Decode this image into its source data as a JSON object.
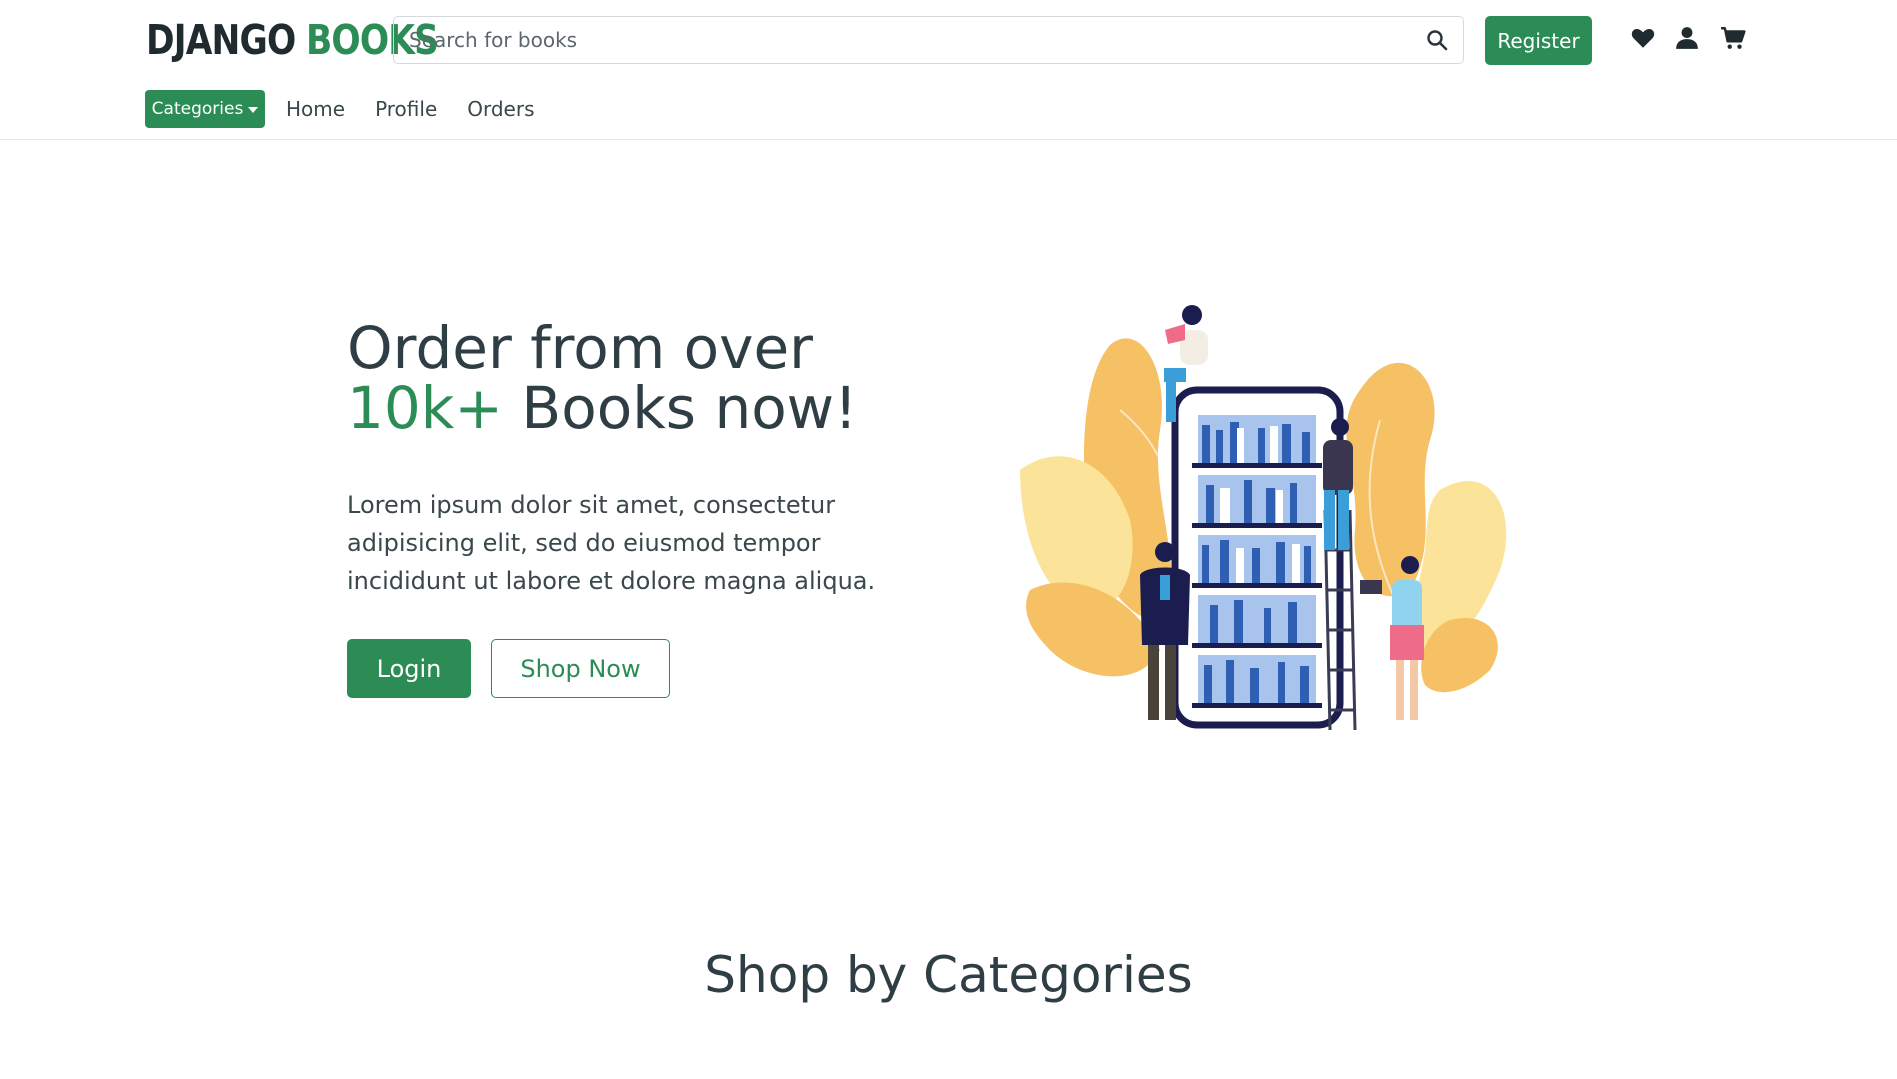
{
  "brand": {
    "part1": "DJANGO",
    "part2": "BOOKS",
    "color": "#2c8c56"
  },
  "search": {
    "placeholder": "Search for books",
    "value": ""
  },
  "header": {
    "register_label": "Register",
    "icons": [
      "heart-icon",
      "user-icon",
      "cart-icon"
    ]
  },
  "nav": {
    "categories_label": "Categories",
    "links": [
      {
        "label": "Home"
      },
      {
        "label": "Profile"
      },
      {
        "label": "Orders"
      }
    ]
  },
  "hero": {
    "title_line1": "Order from over",
    "title_accent": "10k+",
    "title_rest": " Books now!",
    "description": "Lorem ipsum dolor sit amet, consectetur adipisicing elit, sed do eiusmod tempor incididunt ut labore et dolore magna aliqua.",
    "login_label": "Login",
    "shop_label": "Shop Now"
  },
  "section": {
    "title": "Shop by Categories"
  },
  "colors": {
    "accent": "#2c8c56",
    "text": "#2f3d44",
    "illustration_leaf": "#f5c164",
    "shelf": "#1c1d4f"
  }
}
